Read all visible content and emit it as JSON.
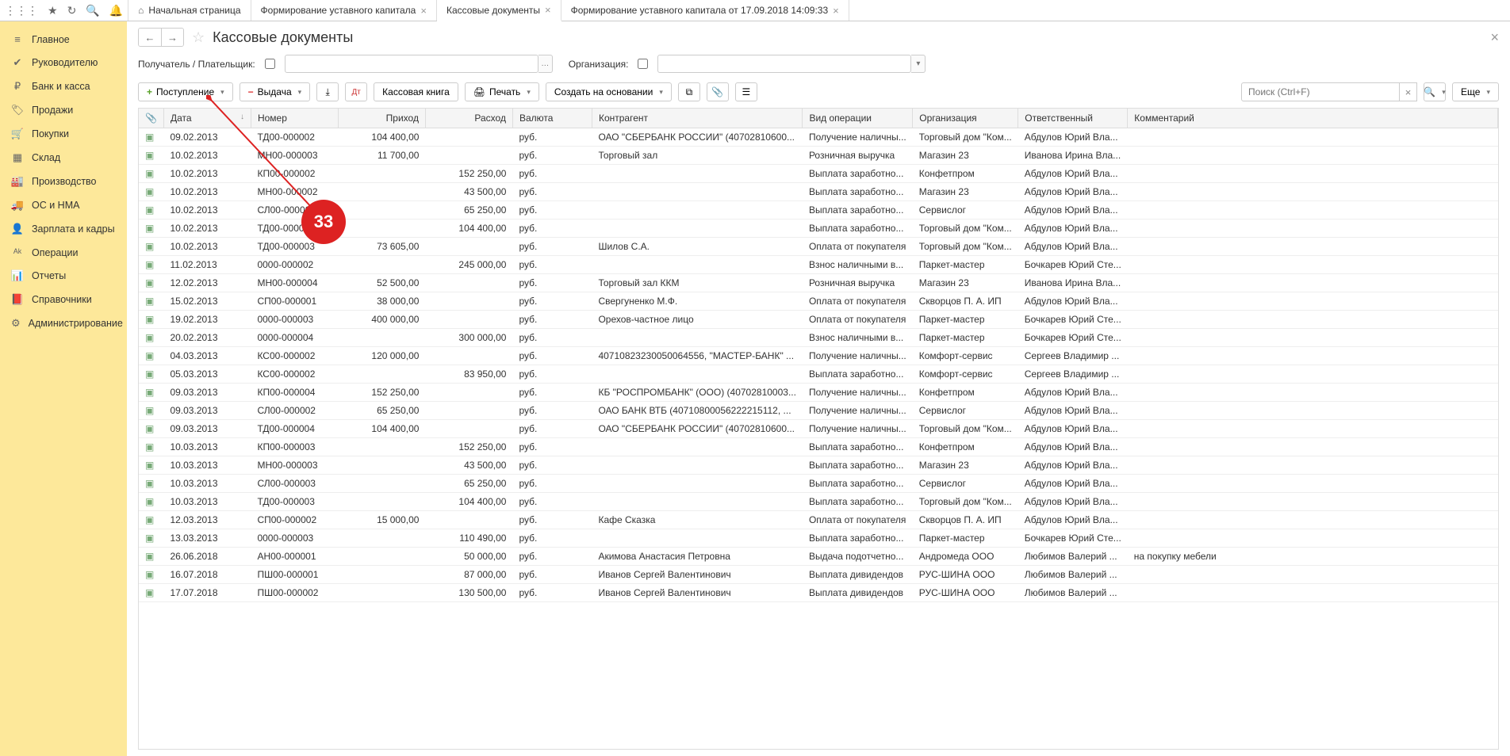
{
  "tabs": [
    {
      "label": "Начальная страница",
      "home": true,
      "closable": false
    },
    {
      "label": "Формирование уставного капитала",
      "closable": true
    },
    {
      "label": "Кассовые документы",
      "closable": true,
      "active": true
    },
    {
      "label": "Формирование уставного капитала от 17.09.2018 14:09:33",
      "closable": true
    }
  ],
  "sidebar": [
    {
      "icon": "≡",
      "label": "Главное"
    },
    {
      "icon": "✔",
      "label": "Руководителю"
    },
    {
      "icon": "₽",
      "label": "Банк и касса"
    },
    {
      "icon": "🏷",
      "label": "Продажи"
    },
    {
      "icon": "🛒",
      "label": "Покупки"
    },
    {
      "icon": "▦",
      "label": "Склад"
    },
    {
      "icon": "🏭",
      "label": "Производство"
    },
    {
      "icon": "🚚",
      "label": "ОС и НМА"
    },
    {
      "icon": "👤",
      "label": "Зарплата и кадры"
    },
    {
      "icon": "ᴬᵏ",
      "label": "Операции"
    },
    {
      "icon": "📊",
      "label": "Отчеты"
    },
    {
      "icon": "📕",
      "label": "Справочники"
    },
    {
      "icon": "⚙",
      "label": "Администрирование"
    }
  ],
  "page_title": "Кассовые документы",
  "filters": {
    "payer_label": "Получатель / Плательщик:",
    "org_label": "Организация:"
  },
  "toolbar": {
    "receipt": "Поступление",
    "issue": "Выдача",
    "cashbook": "Кассовая книга",
    "print": "Печать",
    "create_based": "Создать на основании",
    "search_ph": "Поиск (Ctrl+F)",
    "more": "Еще"
  },
  "columns": {
    "att": "📎",
    "date": "Дата",
    "num": "Номер",
    "in": "Приход",
    "out": "Расход",
    "cur": "Валюта",
    "agent": "Контрагент",
    "op": "Вид операции",
    "org": "Организация",
    "resp": "Ответственный",
    "comment": "Комментарий"
  },
  "rows": [
    {
      "date": "09.02.2013",
      "num": "ТД00-000002",
      "in": "104 400,00",
      "out": "",
      "cur": "руб.",
      "agent": "ОАО \"СБЕРБАНК РОССИИ\" (40702810600...",
      "op": "Получение наличны...",
      "org": "Торговый дом \"Ком...",
      "resp": "Абдулов Юрий Вла...",
      "comment": ""
    },
    {
      "date": "10.02.2013",
      "num": "МН00-000003",
      "in": "11 700,00",
      "out": "",
      "cur": "руб.",
      "agent": "Торговый зал",
      "op": "Розничная выручка",
      "org": "Магазин 23",
      "resp": "Иванова Ирина Вла...",
      "comment": ""
    },
    {
      "date": "10.02.2013",
      "num": "КП00-000002",
      "in": "",
      "out": "152 250,00",
      "cur": "руб.",
      "agent": "",
      "op": "Выплата заработно...",
      "org": "Конфетпром",
      "resp": "Абдулов Юрий Вла...",
      "comment": ""
    },
    {
      "date": "10.02.2013",
      "num": "МН00-000002",
      "in": "",
      "out": "43 500,00",
      "cur": "руб.",
      "agent": "",
      "op": "Выплата заработно...",
      "org": "Магазин 23",
      "resp": "Абдулов Юрий Вла...",
      "comment": ""
    },
    {
      "date": "10.02.2013",
      "num": "СЛ00-000002",
      "in": "",
      "out": "65 250,00",
      "cur": "руб.",
      "agent": "",
      "op": "Выплата заработно...",
      "org": "Сервислог",
      "resp": "Абдулов Юрий Вла...",
      "comment": ""
    },
    {
      "date": "10.02.2013",
      "num": "ТД00-000002",
      "in": "",
      "out": "104 400,00",
      "cur": "руб.",
      "agent": "",
      "op": "Выплата заработно...",
      "org": "Торговый дом \"Ком...",
      "resp": "Абдулов Юрий Вла...",
      "comment": ""
    },
    {
      "date": "10.02.2013",
      "num": "ТД00-000003",
      "in": "73 605,00",
      "out": "",
      "cur": "руб.",
      "agent": "Шилов С.А.",
      "op": "Оплата от покупателя",
      "org": "Торговый дом \"Ком...",
      "resp": "Абдулов Юрий Вла...",
      "comment": ""
    },
    {
      "date": "11.02.2013",
      "num": "0000-000002",
      "in": "",
      "out": "245 000,00",
      "cur": "руб.",
      "agent": "",
      "op": "Взнос наличными в...",
      "org": "Паркет-мастер",
      "resp": "Бочкарев Юрий Сте...",
      "comment": ""
    },
    {
      "date": "12.02.2013",
      "num": "МН00-000004",
      "in": "52 500,00",
      "out": "",
      "cur": "руб.",
      "agent": "Торговый зал ККМ",
      "op": "Розничная выручка",
      "org": "Магазин 23",
      "resp": "Иванова Ирина Вла...",
      "comment": ""
    },
    {
      "date": "15.02.2013",
      "num": "СП00-000001",
      "in": "38 000,00",
      "out": "",
      "cur": "руб.",
      "agent": "Свергуненко М.Ф.",
      "op": "Оплата от покупателя",
      "org": "Скворцов П. А. ИП",
      "resp": "Абдулов Юрий Вла...",
      "comment": ""
    },
    {
      "date": "19.02.2013",
      "num": "0000-000003",
      "in": "400 000,00",
      "out": "",
      "cur": "руб.",
      "agent": "Орехов-частное лицо",
      "op": "Оплата от покупателя",
      "org": "Паркет-мастер",
      "resp": "Бочкарев Юрий Сте...",
      "comment": ""
    },
    {
      "date": "20.02.2013",
      "num": "0000-000004",
      "in": "",
      "out": "300 000,00",
      "cur": "руб.",
      "agent": "",
      "op": "Взнос наличными в...",
      "org": "Паркет-мастер",
      "resp": "Бочкарев Юрий Сте...",
      "comment": ""
    },
    {
      "date": "04.03.2013",
      "num": "КС00-000002",
      "in": "120 000,00",
      "out": "",
      "cur": "руб.",
      "agent": "40710823230050064556, \"МАСТЕР-БАНК\" ...",
      "op": "Получение наличны...",
      "org": "Комфорт-сервис",
      "resp": "Сергеев Владимир ...",
      "comment": ""
    },
    {
      "date": "05.03.2013",
      "num": "КС00-000002",
      "in": "",
      "out": "83 950,00",
      "cur": "руб.",
      "agent": "",
      "op": "Выплата заработно...",
      "org": "Комфорт-сервис",
      "resp": "Сергеев Владимир ...",
      "comment": ""
    },
    {
      "date": "09.03.2013",
      "num": "КП00-000004",
      "in": "152 250,00",
      "out": "",
      "cur": "руб.",
      "agent": "КБ \"РОСПРОМБАНК\" (ООО) (40702810003...",
      "op": "Получение наличны...",
      "org": "Конфетпром",
      "resp": "Абдулов Юрий Вла...",
      "comment": ""
    },
    {
      "date": "09.03.2013",
      "num": "СЛ00-000002",
      "in": "65 250,00",
      "out": "",
      "cur": "руб.",
      "agent": "ОАО БАНК ВТБ (40710800056222215112, ...",
      "op": "Получение наличны...",
      "org": "Сервислог",
      "resp": "Абдулов Юрий Вла...",
      "comment": ""
    },
    {
      "date": "09.03.2013",
      "num": "ТД00-000004",
      "in": "104 400,00",
      "out": "",
      "cur": "руб.",
      "agent": "ОАО \"СБЕРБАНК РОССИИ\" (40702810600...",
      "op": "Получение наличны...",
      "org": "Торговый дом \"Ком...",
      "resp": "Абдулов Юрий Вла...",
      "comment": ""
    },
    {
      "date": "10.03.2013",
      "num": "КП00-000003",
      "in": "",
      "out": "152 250,00",
      "cur": "руб.",
      "agent": "",
      "op": "Выплата заработно...",
      "org": "Конфетпром",
      "resp": "Абдулов Юрий Вла...",
      "comment": ""
    },
    {
      "date": "10.03.2013",
      "num": "МН00-000003",
      "in": "",
      "out": "43 500,00",
      "cur": "руб.",
      "agent": "",
      "op": "Выплата заработно...",
      "org": "Магазин 23",
      "resp": "Абдулов Юрий Вла...",
      "comment": ""
    },
    {
      "date": "10.03.2013",
      "num": "СЛ00-000003",
      "in": "",
      "out": "65 250,00",
      "cur": "руб.",
      "agent": "",
      "op": "Выплата заработно...",
      "org": "Сервислог",
      "resp": "Абдулов Юрий Вла...",
      "comment": ""
    },
    {
      "date": "10.03.2013",
      "num": "ТД00-000003",
      "in": "",
      "out": "104 400,00",
      "cur": "руб.",
      "agent": "",
      "op": "Выплата заработно...",
      "org": "Торговый дом \"Ком...",
      "resp": "Абдулов Юрий Вла...",
      "comment": ""
    },
    {
      "date": "12.03.2013",
      "num": "СП00-000002",
      "in": "15 000,00",
      "out": "",
      "cur": "руб.",
      "agent": "Кафе Сказка",
      "op": "Оплата от покупателя",
      "org": "Скворцов П. А. ИП",
      "resp": "Абдулов Юрий Вла...",
      "comment": ""
    },
    {
      "date": "13.03.2013",
      "num": "0000-000003",
      "in": "",
      "out": "110 490,00",
      "cur": "руб.",
      "agent": "",
      "op": "Выплата заработно...",
      "org": "Паркет-мастер",
      "resp": "Бочкарев Юрий Сте...",
      "comment": ""
    },
    {
      "date": "26.06.2018",
      "num": "АН00-000001",
      "in": "",
      "out": "50 000,00",
      "cur": "руб.",
      "agent": "Акимова Анастасия Петровна",
      "op": "Выдача подотчетно...",
      "org": "Андромеда ООО",
      "resp": "Любимов Валерий ...",
      "comment": "на покупку мебели"
    },
    {
      "date": "16.07.2018",
      "num": "ПШ00-000001",
      "in": "",
      "out": "87 000,00",
      "cur": "руб.",
      "agent": "Иванов Сергей Валентинович",
      "op": "Выплата дивидендов",
      "org": "РУС-ШИНА ООО",
      "resp": "Любимов Валерий ...",
      "comment": ""
    },
    {
      "date": "17.07.2018",
      "num": "ПШ00-000002",
      "in": "",
      "out": "130 500,00",
      "cur": "руб.",
      "agent": "Иванов Сергей Валентинович",
      "op": "Выплата дивидендов",
      "org": "РУС-ШИНА ООО",
      "resp": "Любимов Валерий ...",
      "comment": ""
    }
  ],
  "annotation": {
    "badge": "33"
  }
}
